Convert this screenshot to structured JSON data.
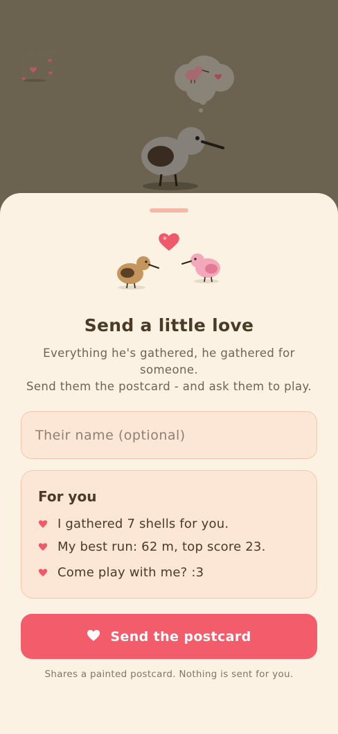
{
  "colors": {
    "backdrop": "#6b624f",
    "sheet": "#fbf2e3",
    "accent": "#f35d6b",
    "heart": "#ef5a6b",
    "card_bg": "#fce7d7",
    "card_border": "#f6c6ac",
    "text_dark": "#4a3a26"
  },
  "sheet": {
    "title": "Send a little love",
    "subtitle_lines": [
      "Everything he's gathered, he gathered for",
      "someone.",
      "Send them the postcard - and ask them to play."
    ]
  },
  "name_field": {
    "placeholder": "Their name (optional)",
    "value": ""
  },
  "card": {
    "title": "For you",
    "lines": [
      "I gathered 7 shells for you.",
      "My best run: 62 m, top score 23.",
      "Come play with me? :3"
    ]
  },
  "send_button": {
    "label": "Send the postcard",
    "icon": "heart-icon"
  },
  "footer_note": "Shares a painted postcard. Nothing is sent for you."
}
